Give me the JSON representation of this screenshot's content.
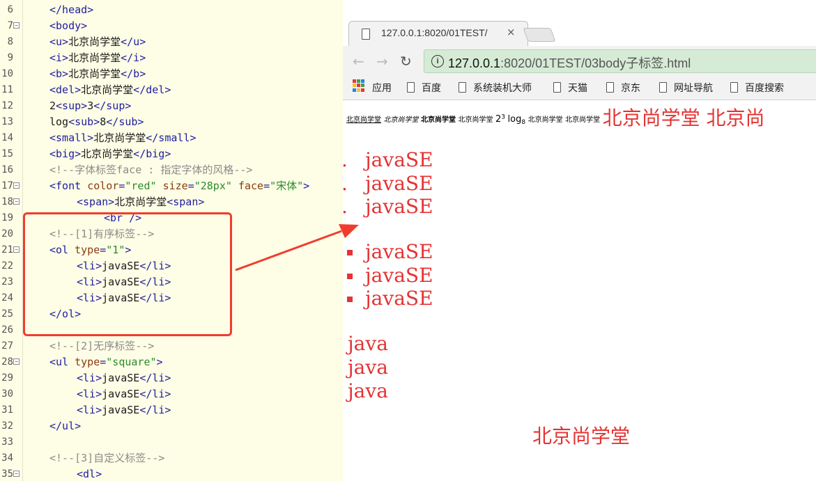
{
  "editor": {
    "lines": [
      {
        "num": "6",
        "fold": false,
        "indent": 1,
        "tokens": [
          [
            "tag",
            "</head>"
          ]
        ]
      },
      {
        "num": "7",
        "fold": true,
        "indent": 1,
        "tokens": [
          [
            "tag",
            "<body>"
          ]
        ]
      },
      {
        "num": "8",
        "fold": false,
        "indent": 1,
        "tokens": [
          [
            "tag",
            "<u>"
          ],
          [
            "txt",
            "北京尚学堂"
          ],
          [
            "tag",
            "</u>"
          ]
        ]
      },
      {
        "num": "9",
        "fold": false,
        "indent": 1,
        "tokens": [
          [
            "tag",
            "<i>"
          ],
          [
            "txt",
            "北京尚学堂"
          ],
          [
            "tag",
            "</i>"
          ]
        ]
      },
      {
        "num": "10",
        "fold": false,
        "indent": 1,
        "tokens": [
          [
            "tag",
            "<b>"
          ],
          [
            "txt",
            "北京尚学堂"
          ],
          [
            "tag",
            "</b>"
          ]
        ]
      },
      {
        "num": "11",
        "fold": false,
        "indent": 1,
        "tokens": [
          [
            "tag",
            "<del>"
          ],
          [
            "txt",
            "北京尚学堂"
          ],
          [
            "tag",
            "</del>"
          ]
        ]
      },
      {
        "num": "12",
        "fold": false,
        "indent": 1,
        "tokens": [
          [
            "txt",
            "2"
          ],
          [
            "tag",
            "<sup>"
          ],
          [
            "txt",
            "3"
          ],
          [
            "tag",
            "</sup>"
          ]
        ]
      },
      {
        "num": "13",
        "fold": false,
        "indent": 1,
        "tokens": [
          [
            "txt",
            "log"
          ],
          [
            "tag",
            "<sub>"
          ],
          [
            "txt",
            "8"
          ],
          [
            "tag",
            "</sub>"
          ]
        ]
      },
      {
        "num": "14",
        "fold": false,
        "indent": 1,
        "tokens": [
          [
            "tag",
            "<small>"
          ],
          [
            "txt",
            "北京尚学堂"
          ],
          [
            "tag",
            "</small>"
          ]
        ]
      },
      {
        "num": "15",
        "fold": false,
        "indent": 1,
        "tokens": [
          [
            "tag",
            "<big>"
          ],
          [
            "txt",
            "北京尚学堂"
          ],
          [
            "tag",
            "</big>"
          ]
        ]
      },
      {
        "num": "16",
        "fold": false,
        "indent": 1,
        "tokens": [
          [
            "cmt",
            "<!--字体标签face : 指定字体的风格-->"
          ]
        ]
      },
      {
        "num": "17",
        "fold": true,
        "indent": 1,
        "tokens": [
          [
            "tag",
            "<font "
          ],
          [
            "attr",
            "color"
          ],
          [
            "tag",
            "="
          ],
          [
            "val",
            "\"red\""
          ],
          [
            "tag",
            " "
          ],
          [
            "attr",
            "size"
          ],
          [
            "tag",
            "="
          ],
          [
            "val",
            "\"28px\""
          ],
          [
            "tag",
            " "
          ],
          [
            "attr",
            "face"
          ],
          [
            "tag",
            "="
          ],
          [
            "val",
            "\"宋体\""
          ],
          [
            "tag",
            ">"
          ]
        ]
      },
      {
        "num": "18",
        "fold": true,
        "indent": 2,
        "tokens": [
          [
            "tag",
            "<span>"
          ],
          [
            "txt",
            "北京尚学堂"
          ],
          [
            "tag",
            "<span>"
          ]
        ]
      },
      {
        "num": "19",
        "fold": false,
        "indent": 3,
        "tokens": [
          [
            "tag",
            "<br />"
          ]
        ]
      },
      {
        "num": "20",
        "fold": false,
        "indent": 1,
        "tokens": [
          [
            "cmt",
            "<!--[1]有序标签-->"
          ]
        ]
      },
      {
        "num": "21",
        "fold": true,
        "indent": 1,
        "tokens": [
          [
            "tag",
            "<ol "
          ],
          [
            "attr",
            "type"
          ],
          [
            "tag",
            "="
          ],
          [
            "val",
            "\"1\""
          ],
          [
            "tag",
            ">"
          ]
        ]
      },
      {
        "num": "22",
        "fold": false,
        "indent": 2,
        "tokens": [
          [
            "tag",
            "<li>"
          ],
          [
            "txt",
            "javaSE"
          ],
          [
            "tag",
            "</li>"
          ]
        ]
      },
      {
        "num": "23",
        "fold": false,
        "indent": 2,
        "tokens": [
          [
            "tag",
            "<li>"
          ],
          [
            "txt",
            "javaSE"
          ],
          [
            "tag",
            "</li>"
          ]
        ]
      },
      {
        "num": "24",
        "fold": false,
        "indent": 2,
        "tokens": [
          [
            "tag",
            "<li>"
          ],
          [
            "txt",
            "javaSE"
          ],
          [
            "tag",
            "</li>"
          ]
        ]
      },
      {
        "num": "25",
        "fold": false,
        "indent": 1,
        "tokens": [
          [
            "tag",
            "</ol>"
          ]
        ]
      },
      {
        "num": "26",
        "fold": false,
        "indent": 0,
        "tokens": []
      },
      {
        "num": "27",
        "fold": false,
        "indent": 1,
        "tokens": [
          [
            "cmt",
            "<!--[2]无序标签-->"
          ]
        ]
      },
      {
        "num": "28",
        "fold": true,
        "indent": 1,
        "tokens": [
          [
            "tag",
            "<ul "
          ],
          [
            "attr",
            "type"
          ],
          [
            "tag",
            "="
          ],
          [
            "val",
            "\"square\""
          ],
          [
            "tag",
            ">"
          ]
        ]
      },
      {
        "num": "29",
        "fold": false,
        "indent": 2,
        "tokens": [
          [
            "tag",
            "<li>"
          ],
          [
            "txt",
            "javaSE"
          ],
          [
            "tag",
            "</li>"
          ]
        ]
      },
      {
        "num": "30",
        "fold": false,
        "indent": 2,
        "tokens": [
          [
            "tag",
            "<li>"
          ],
          [
            "txt",
            "javaSE"
          ],
          [
            "tag",
            "</li>"
          ]
        ]
      },
      {
        "num": "31",
        "fold": false,
        "indent": 2,
        "tokens": [
          [
            "tag",
            "<li>"
          ],
          [
            "txt",
            "javaSE"
          ],
          [
            "tag",
            "</li>"
          ]
        ]
      },
      {
        "num": "32",
        "fold": false,
        "indent": 1,
        "tokens": [
          [
            "tag",
            "</ul>"
          ]
        ]
      },
      {
        "num": "33",
        "fold": false,
        "indent": 0,
        "tokens": []
      },
      {
        "num": "34",
        "fold": false,
        "indent": 1,
        "tokens": [
          [
            "cmt",
            "<!--[3]自定义标签-->"
          ]
        ]
      },
      {
        "num": "35",
        "fold": true,
        "indent": 2,
        "tokens": [
          [
            "tag",
            "<dl>"
          ]
        ]
      }
    ]
  },
  "browser": {
    "tab_title": "127.0.0.1:8020/01TEST/",
    "tab_close": "×",
    "nav": {
      "back": "←",
      "forward": "→",
      "reload": "↻"
    },
    "url_host": "127.0.0.1",
    "url_path": ":8020/01TEST/03body子标签.html",
    "info_icon": "i",
    "bookmarks": [
      "应用",
      "百度",
      "系统装机大师",
      "天猫",
      "京东",
      "网址导航",
      "百度搜索"
    ],
    "apps_icon_colors": [
      "#e53935",
      "#43a047",
      "#1e88e5",
      "#fbc02d",
      "#e53935",
      "#43a047",
      "#1e88e5",
      "#fbc02d",
      "#e53935"
    ]
  },
  "page": {
    "inline": {
      "u": "北京尚学堂",
      "i": "北京尚学堂",
      "b": "北京尚学堂",
      "del": "北京尚学堂",
      "sup_base": "2",
      "sup": "3",
      "sub_base": "log",
      "sub": "8",
      "small": "北京尚学堂",
      "big": "北京尚学堂",
      "font": "北京尚学堂  北京尚"
    },
    "ol_items": [
      "javaSE",
      "javaSE",
      "javaSE"
    ],
    "ol_markers": [
      ".",
      ".",
      "."
    ],
    "ul_items": [
      "javaSE",
      "javaSE",
      "javaSE"
    ],
    "dl_items": [
      "java",
      "java",
      "java"
    ],
    "dd_text": "北京尚学堂",
    "text_color": "#e53333"
  },
  "annotation_color": "#f03c2e"
}
